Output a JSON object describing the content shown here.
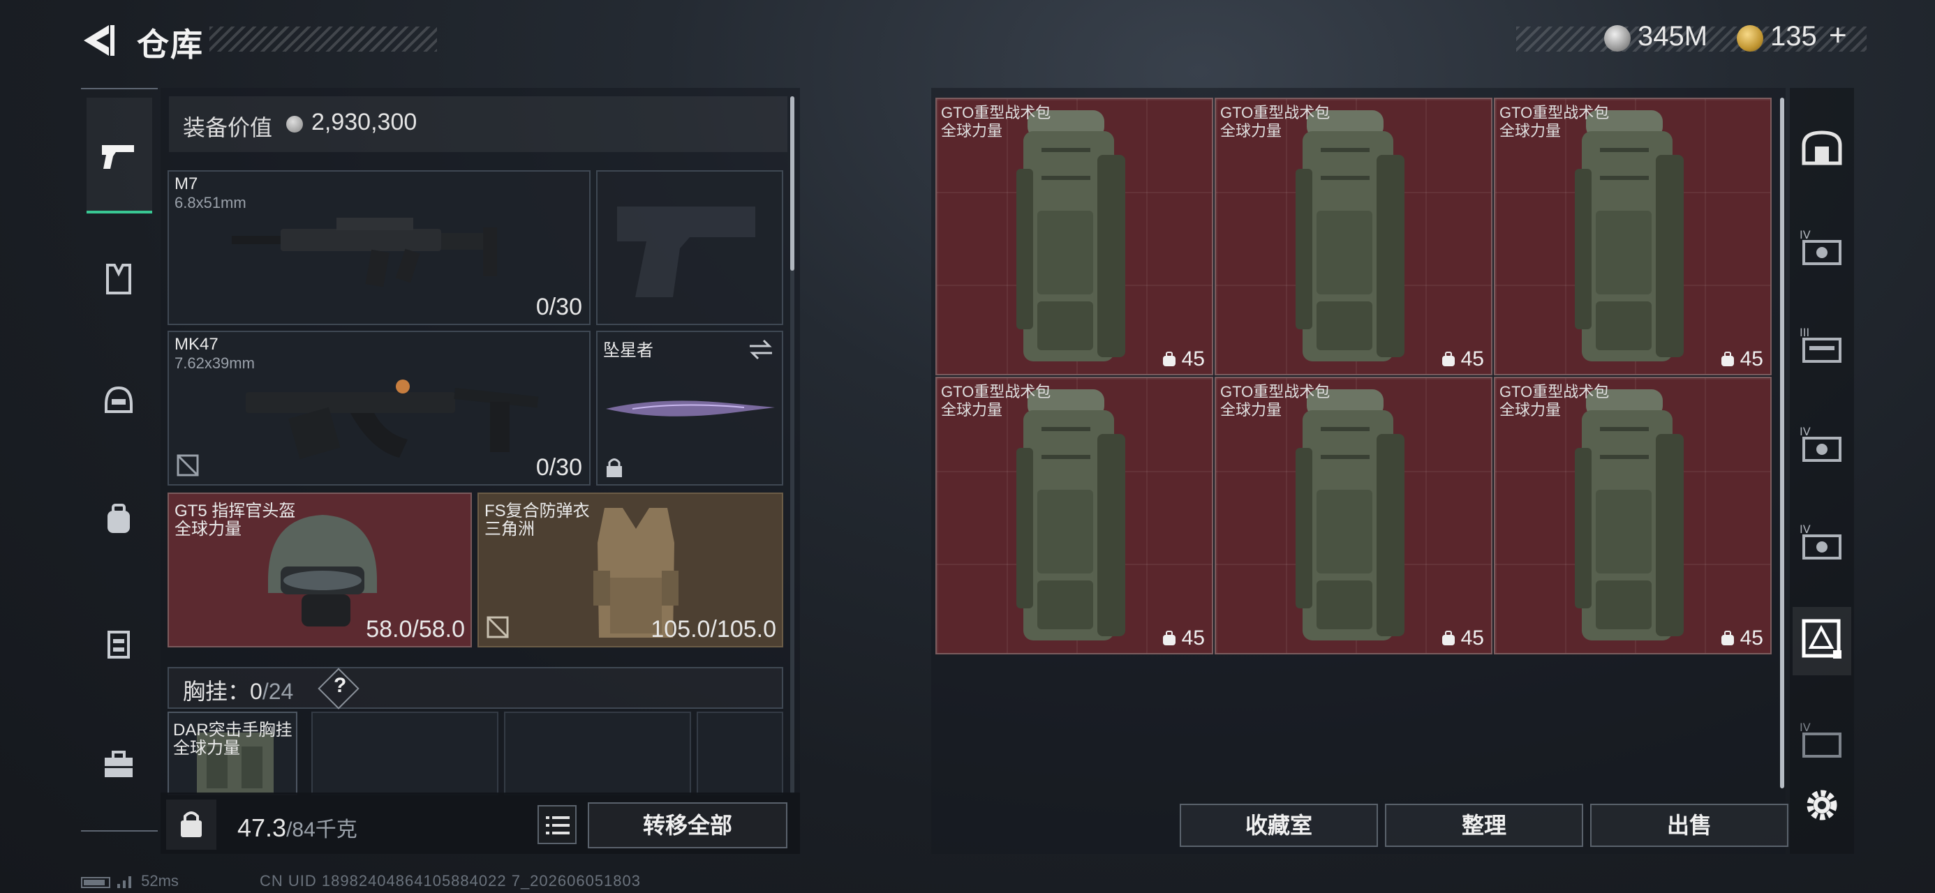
{
  "header": {
    "title": "仓库",
    "currency1": "345M",
    "currency2": "135",
    "currency2_add": "+"
  },
  "left_rail": {
    "items": [
      "pistol-icon",
      "armor-vest-icon",
      "helmet-icon",
      "backpack-icon",
      "chest-rig-icon",
      "toolbox-icon"
    ],
    "selected": "pistol-icon"
  },
  "loadout": {
    "equip_label": "装备价值",
    "equip_value": "2,930,300",
    "primary": {
      "name": "M7",
      "caliber": "6.8x51mm",
      "ammo": "0/30"
    },
    "secondary": {
      "name": "MK47",
      "caliber": "7.62x39mm",
      "ammo": "0/30"
    },
    "melee": {
      "name": "坠星者"
    },
    "helmet": {
      "name": "GT5 指挥官头盔",
      "origin": "全球力量",
      "durability": "58.0/58.0"
    },
    "armor": {
      "name": "FS复合防弹衣",
      "origin": "三角洲",
      "durability": "105.0/105.0"
    },
    "chest_label": "胸挂：",
    "chest_count": "0",
    "chest_capacity": "/24",
    "chest_help": "?",
    "chest_item": {
      "name": "DAR突击手胸挂",
      "origin": "全球力量"
    },
    "weight": "47.3",
    "weight_max": "/84千克",
    "transfer_all": "转移全部"
  },
  "storage": {
    "items": [
      {
        "name": "GTO重型战术包",
        "origin": "全球力量",
        "count": "45"
      },
      {
        "name": "GTO重型战术包",
        "origin": "全球力量",
        "count": "45"
      },
      {
        "name": "GTO重型战术包",
        "origin": "全球力量",
        "count": "45"
      },
      {
        "name": "GTO重型战术包",
        "origin": "全球力量",
        "count": "45"
      },
      {
        "name": "GTO重型战术包",
        "origin": "全球力量",
        "count": "45"
      },
      {
        "name": "GTO重型战术包",
        "origin": "全球力量",
        "count": "45"
      }
    ],
    "buttons": {
      "collection": "收藏室",
      "sort": "整理",
      "sell": "出售"
    }
  },
  "right_tabs": [
    "safe-box-icon",
    "tier-iv-case-icon",
    "tier-iii-case-icon",
    "tier-iv-case-icon",
    "tier-iv-case-icon",
    "backpack-storage-icon",
    "tier-iv-case-icon"
  ],
  "footer": {
    "ping": "52ms",
    "uid": "CN UID 18982404864105884022 7_202606051803"
  }
}
